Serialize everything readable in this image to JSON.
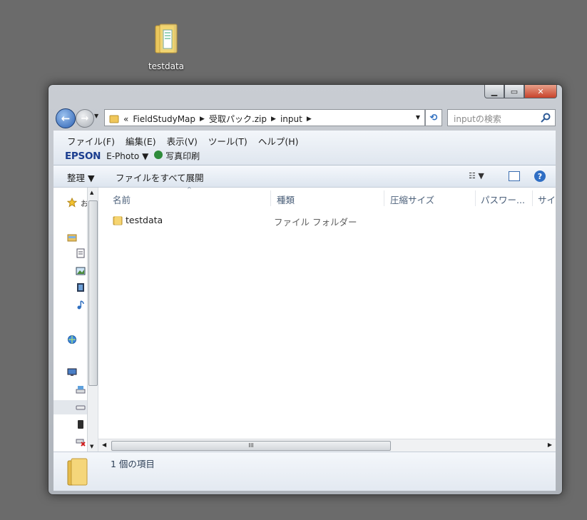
{
  "desktop": {
    "icon_label": "testdata"
  },
  "window": {
    "controls": {
      "minimize": "▁",
      "maximize": "▭",
      "close": "✕"
    }
  },
  "address_bar": {
    "overflow": "«",
    "crumbs": [
      "FieldStudyMap",
      "受取パック.zip",
      "input"
    ]
  },
  "search": {
    "placeholder": "inputの検索"
  },
  "menu": {
    "items": [
      "ファイル(F)",
      "編集(E)",
      "表示(V)",
      "ツール(T)",
      "ヘルプ(H)"
    ]
  },
  "epson_bar": {
    "brand": "EPSON",
    "app": "E-Photo",
    "print": "写真印刷"
  },
  "toolbar": {
    "organize": "整理",
    "extract_all": "ファイルをすべて展開"
  },
  "columns": [
    "名前",
    "種類",
    "圧縮サイズ",
    "パスワー...",
    "サイ"
  ],
  "files": [
    {
      "name": "testdata",
      "type": "ファイル フォルダー"
    }
  ],
  "scroll": {
    "grip": "III"
  },
  "status": {
    "item_count": "1 個の項目"
  },
  "nav_pane": {
    "fav_partial": "お"
  },
  "colors": {
    "desktop": "#6b6b6b",
    "folder": "#f0c75a",
    "accent": "#2f6ec4"
  },
  "icons": [
    "back-icon",
    "forward-icon",
    "folder-icon",
    "refresh-icon",
    "search-icon",
    "help-icon",
    "views-icon",
    "preview-pane-icon",
    "star-icon",
    "library-icon",
    "document-icon",
    "picture-icon",
    "video-icon",
    "music-icon",
    "network-icon",
    "computer-icon",
    "drive-icon"
  ]
}
